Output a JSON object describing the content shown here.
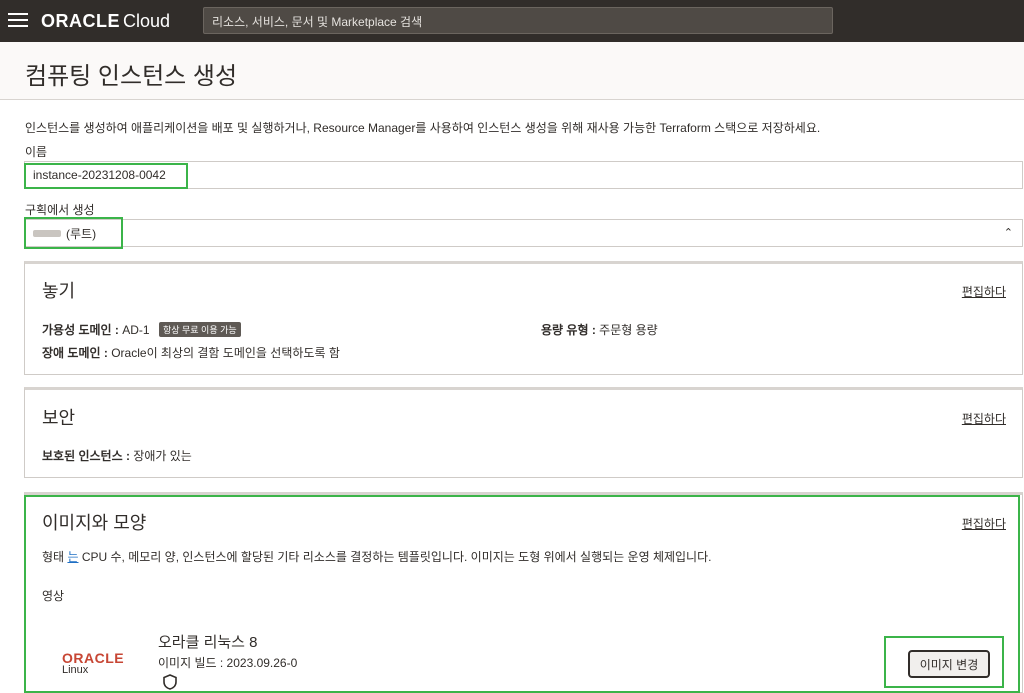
{
  "header": {
    "brand": "ORACLE",
    "product": "Cloud",
    "search_placeholder": "리소스, 서비스, 문서 및 Marketplace 검색"
  },
  "page": {
    "title": "컴퓨팅 인스턴스 생성",
    "description": "인스턴스를 생성하여 애플리케이션을 배포 및 실행하거나, Resource Manager를 사용하여 인스턴스 생성을 위해 재사용 가능한 Terraform 스택으로 저장하세요."
  },
  "form": {
    "name_label": "이름",
    "name_value": "instance-20231208-0042",
    "compartment_label": "구획에서 생성",
    "compartment_value": "(루트)"
  },
  "placement": {
    "title": "놓기",
    "edit": "편집하다",
    "ad_label": "가용성 도메인 :",
    "ad_value": "AD-1",
    "ad_badge": "항상 무료 이용 가능",
    "capacity_label": "용량 유형 :",
    "capacity_value": "주문형 용량",
    "fd_label": "장애 도메인 :",
    "fd_value": "Oracle이 최상의 결함 도메인을 선택하도록 함"
  },
  "security": {
    "title": "보안",
    "edit": "편집하다",
    "shielded_label": "보호된 인스턴스 :",
    "shielded_value": "장애가 있는"
  },
  "image_shape": {
    "title": "이미지와 모양",
    "edit": "편집하다",
    "desc_prefix": "형태",
    "desc_link": "는",
    "desc_rest": "CPU 수, 메모리 양, 인스턴스에 할당된 기타 리소스를 결정하는 템플릿입니다. 이미지는 도형 위에서 실행되는 운영 체제입니다.",
    "image_label": "영상",
    "image_name": "오라클 리눅스 8",
    "build_label": "이미지 빌드 :",
    "build_value": "2023.09.26-0",
    "logo_brand": "ORACLE",
    "logo_sub": "Linux",
    "change_button": "이미지 변경"
  },
  "colors": {
    "topbar": "#312d2a",
    "highlight": "#3bb449",
    "oracle_red": "#c74634"
  },
  "icons": [
    "menu-icon",
    "chevron-updown-icon",
    "shield-icon"
  ]
}
